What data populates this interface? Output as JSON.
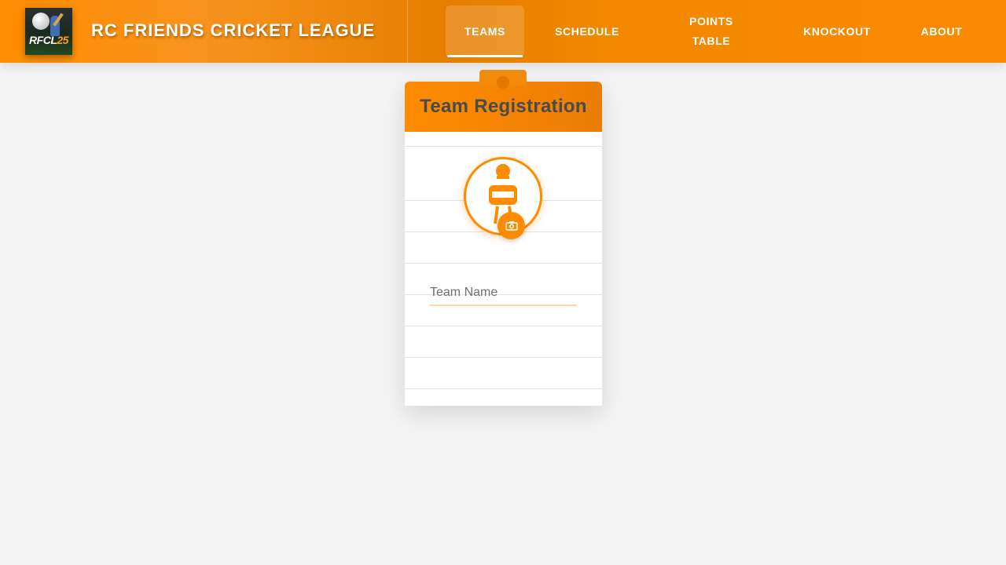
{
  "app": {
    "logo": {
      "text_main": "RFCL",
      "text_accent": "25"
    },
    "title": "RC FRIENDS CRICKET LEAGUE"
  },
  "nav": {
    "items": [
      {
        "label": "TEAMS",
        "active": true
      },
      {
        "label": "SCHEDULE",
        "active": false
      },
      {
        "label": "POINTS TABLE",
        "active": false
      },
      {
        "label": "KNOCKOUT",
        "active": false
      },
      {
        "label": "ABOUT",
        "active": false
      }
    ]
  },
  "card": {
    "title": "Team Registration",
    "avatar_icon": "cricket-player-icon",
    "upload_icon": "camera-icon",
    "team_name": {
      "placeholder": "Team Name",
      "value": ""
    }
  },
  "colors": {
    "accent": "#ff8c00",
    "header_text": "#ffffff",
    "card_title": "#4a4a4a",
    "background": "#f4f4f4"
  }
}
